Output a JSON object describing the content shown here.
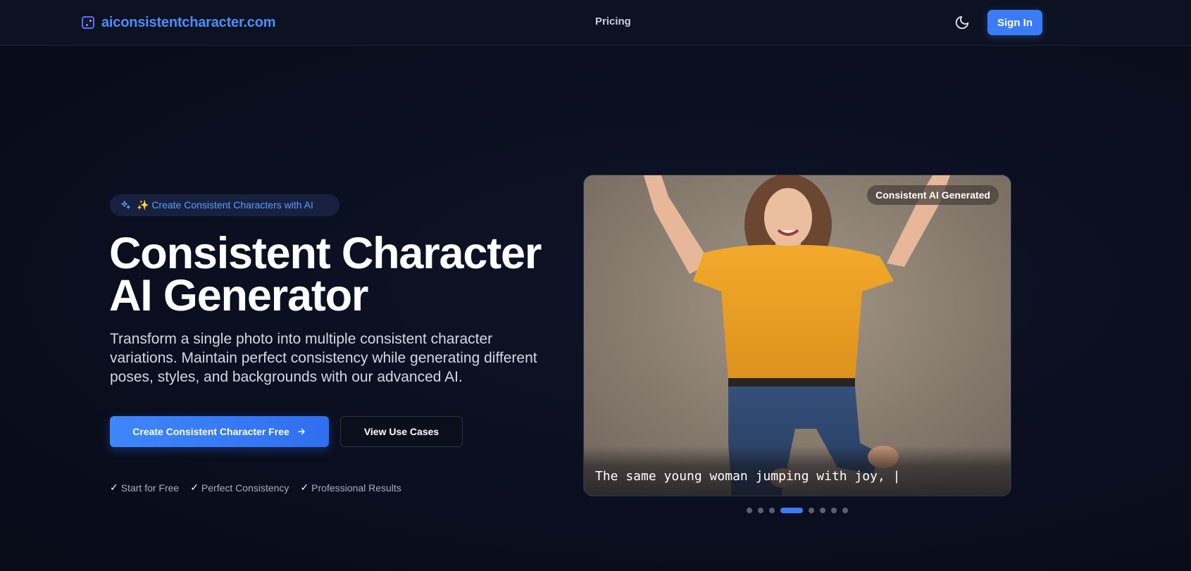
{
  "header": {
    "brand": "aiconsistentcharacter.com",
    "nav_pricing": "Pricing",
    "theme_icon": "moon-icon",
    "signin_label": "Sign In"
  },
  "hero": {
    "badge_text": "✨ Create Consistent Characters with AI",
    "title_line1": "Consistent Character",
    "title_line2": "AI Generator",
    "description": "Transform a single photo into multiple consistent character variations. Maintain perfect consistency while generating different poses, styles, and backgrounds with our advanced AI.",
    "primary_cta": "Create Consistent Character Free",
    "secondary_cta": "View Use Cases",
    "features": [
      "Start for Free",
      "Perfect Consistency",
      "Professional Results"
    ]
  },
  "showcase": {
    "badge": "Consistent AI Generated",
    "caption": "The same young woman jumping with joy, |",
    "total_slides": 8,
    "active_slide": 4
  },
  "colors": {
    "accent": "#3b7bf6",
    "brand_text": "#4d8dff",
    "background": "#0a0e1e"
  }
}
